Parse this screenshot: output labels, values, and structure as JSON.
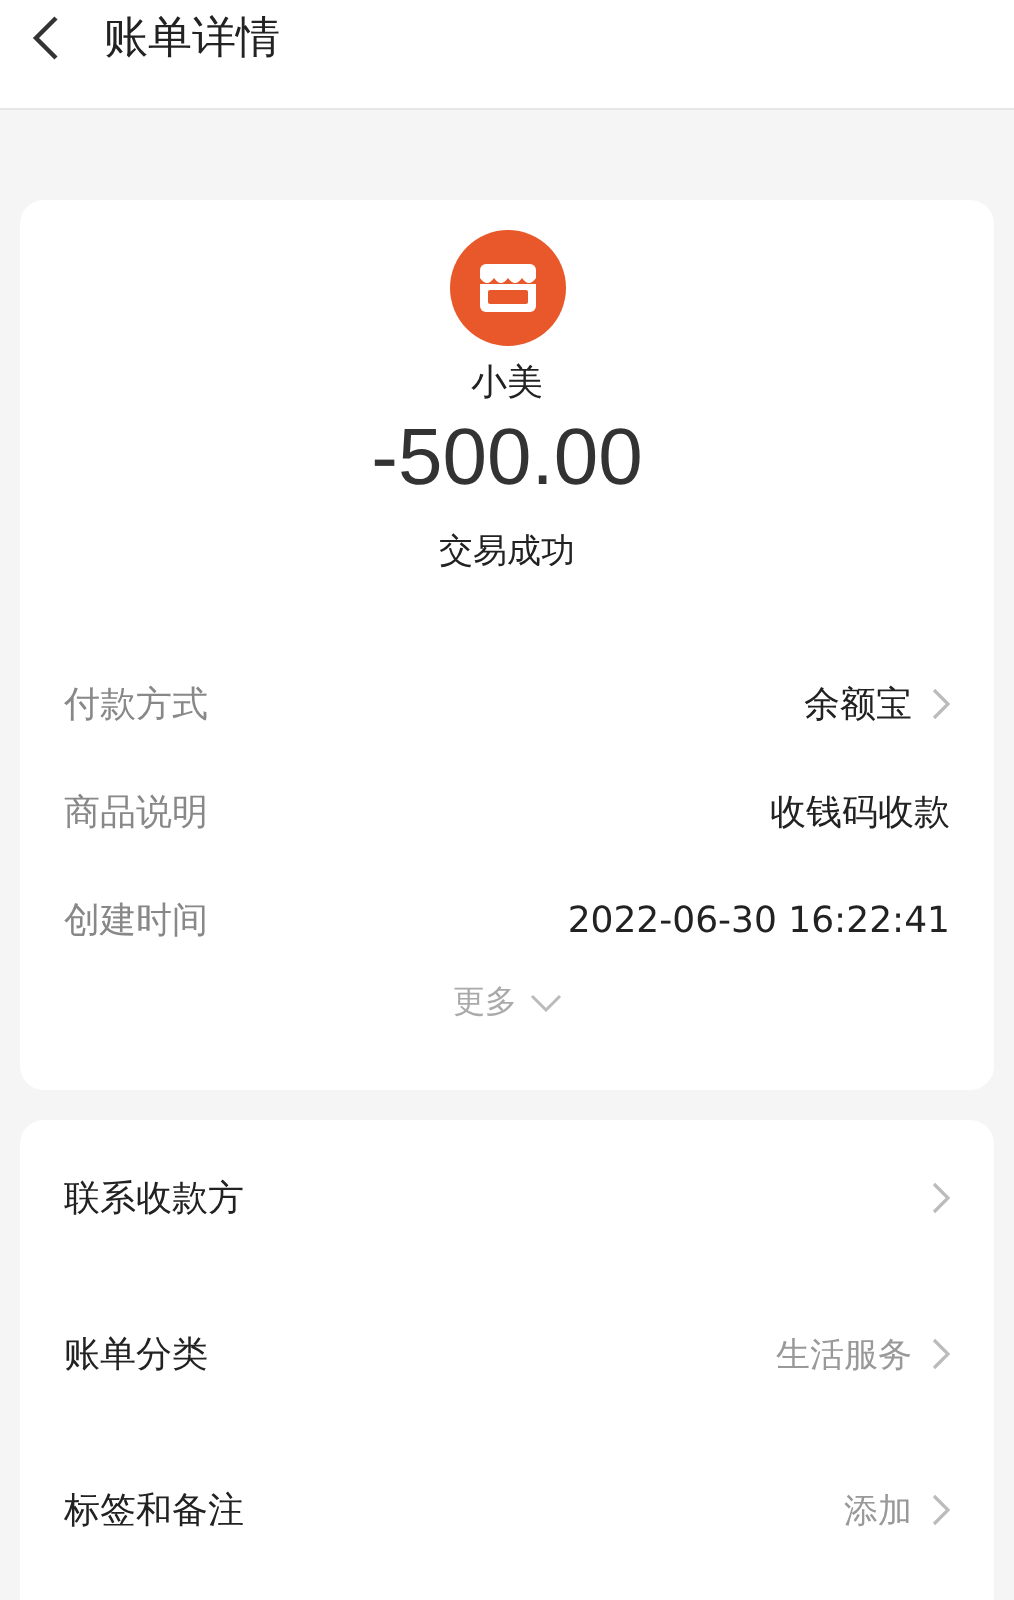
{
  "header": {
    "title": "账单详情"
  },
  "summary": {
    "merchant": "小美",
    "amount": "-500.00",
    "status": "交易成功"
  },
  "details": [
    {
      "label": "付款方式",
      "value": "余额宝",
      "has_arrow": true
    },
    {
      "label": "商品说明",
      "value": "收钱码收款",
      "has_arrow": false
    },
    {
      "label": "创建时间",
      "value": "2022-06-30 16:22:41",
      "has_arrow": false
    }
  ],
  "more": "更多",
  "actions": [
    {
      "label": "联系收款方"
    },
    {
      "label": "账单分类",
      "value": "生活服务"
    },
    {
      "label": "标签和备注",
      "value": "添加"
    }
  ]
}
